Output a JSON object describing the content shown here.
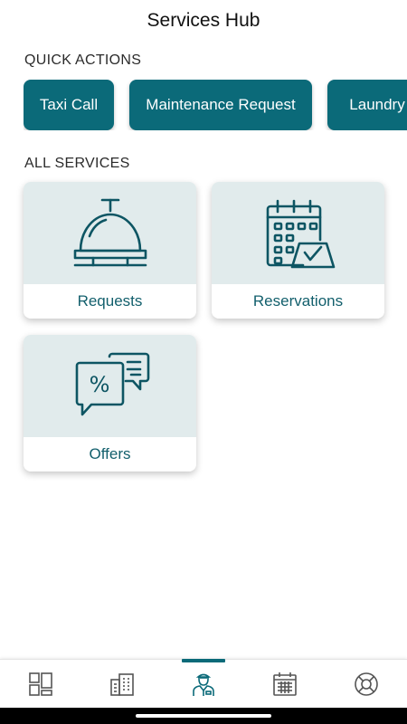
{
  "header": {
    "title": "Services Hub"
  },
  "quick_actions": {
    "label": "QUICK ACTIONS",
    "items": [
      "Taxi Call",
      "Maintenance Request",
      "Laundry"
    ]
  },
  "all_services": {
    "label": "ALL SERVICES",
    "cards": [
      {
        "label": "Requests",
        "icon": "service-bell-icon"
      },
      {
        "label": "Reservations",
        "icon": "calendar-booking-icon"
      },
      {
        "label": "Offers",
        "icon": "discount-chat-icon"
      }
    ]
  },
  "bottom_nav": {
    "items": [
      {
        "icon": "dashboard-icon",
        "active": false
      },
      {
        "icon": "building-icon",
        "active": false
      },
      {
        "icon": "concierge-icon",
        "active": true
      },
      {
        "icon": "calendar-icon",
        "active": false
      },
      {
        "icon": "lifebuoy-icon",
        "active": false
      }
    ]
  },
  "colors": {
    "accent": "#0b6a79",
    "card_art_bg": "#e1ebec",
    "label_text": "#125f6c"
  }
}
